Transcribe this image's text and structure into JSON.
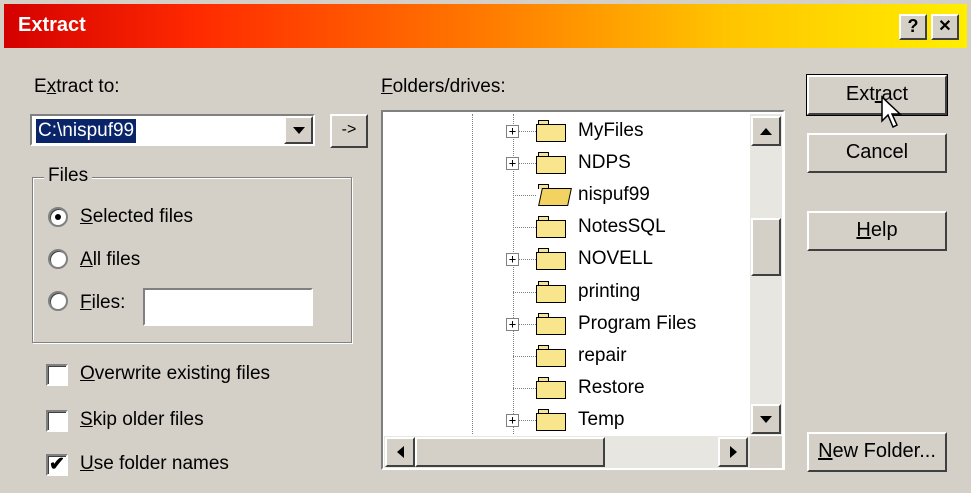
{
  "window": {
    "title": "Extract",
    "help_button": "?",
    "close_button": "✕"
  },
  "extract_to": {
    "label_pre": "E",
    "label_ul": "x",
    "label_post": "tract to:",
    "value": "C:\\nispuf99",
    "go_button": "->"
  },
  "files_group": {
    "legend": "Files",
    "options": [
      {
        "ul": "S",
        "rest": "elected files",
        "selected": true
      },
      {
        "ul": "A",
        "rest": "ll files",
        "selected": false
      },
      {
        "ul": "F",
        "rest": "iles:",
        "selected": false
      }
    ],
    "files_value": ""
  },
  "checkboxes": [
    {
      "ul": "O",
      "rest": "verwrite existing files",
      "checked": false
    },
    {
      "ul": "S",
      "rest": "kip older files",
      "checked": false
    },
    {
      "ul": "U",
      "rest": "se folder names",
      "checked": true
    }
  ],
  "folders": {
    "label_ul": "F",
    "label_rest": "olders/drives:",
    "items": [
      {
        "label": "MyFiles",
        "expandable": true
      },
      {
        "label": "NDPS",
        "expandable": true
      },
      {
        "label": "nispuf99",
        "expandable": false,
        "open": true
      },
      {
        "label": "NotesSQL",
        "expandable": false
      },
      {
        "label": "NOVELL",
        "expandable": true
      },
      {
        "label": "printing",
        "expandable": false
      },
      {
        "label": "Program Files",
        "expandable": true
      },
      {
        "label": "repair",
        "expandable": false
      },
      {
        "label": "Restore",
        "expandable": false
      },
      {
        "label": "Temp",
        "expandable": true
      }
    ]
  },
  "buttons": {
    "extract_pre": "Ext",
    "extract_ul": "r",
    "extract_post": "act",
    "cancel": "Cancel",
    "help_ul": "H",
    "help_rest": "elp",
    "new_folder_ul": "N",
    "new_folder_rest": "ew Folder..."
  },
  "expander_symbol": "+",
  "check_mark": "✔",
  "colors": {
    "title_gradient_start": "#d40000",
    "title_gradient_end": "#ffee00",
    "face": "#d4d0c8",
    "selection": "#0a246a"
  }
}
